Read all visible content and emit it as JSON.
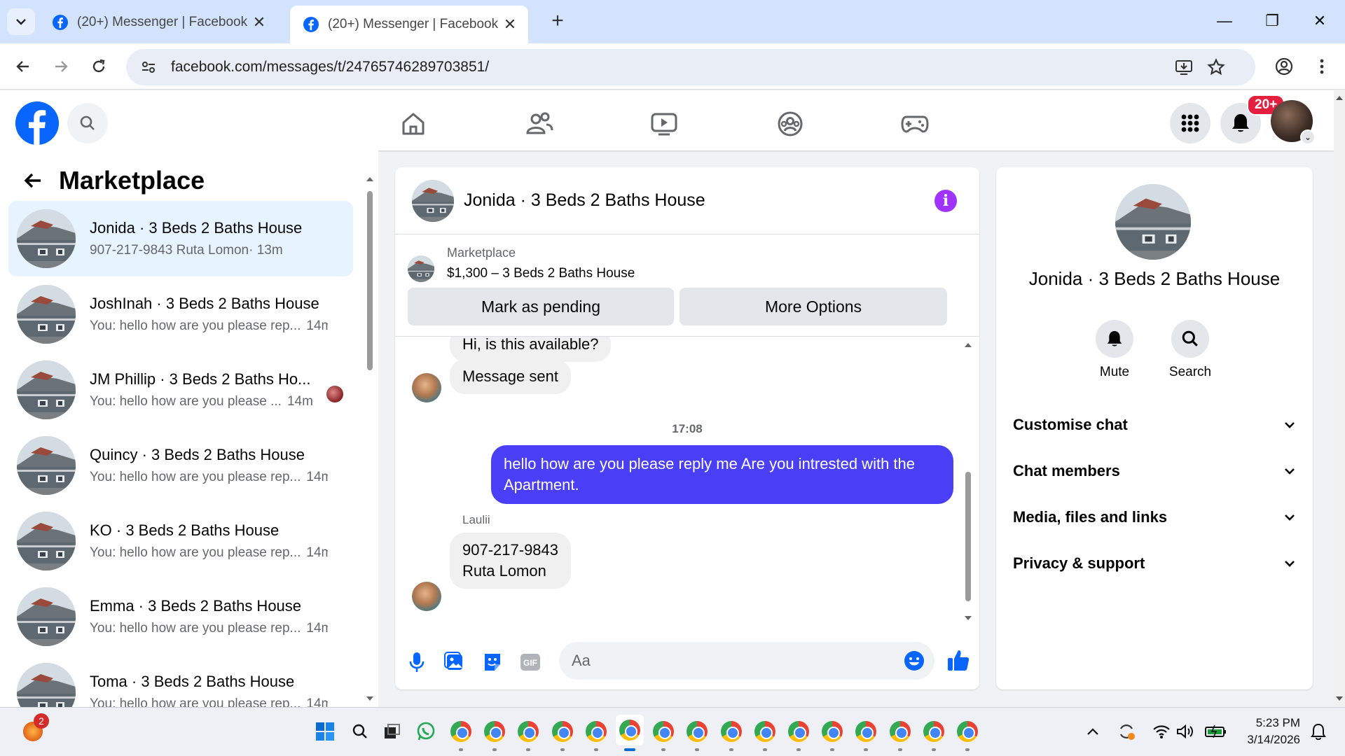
{
  "browser": {
    "tabs": [
      {
        "title": "(20+) Messenger | Facebook",
        "active": false
      },
      {
        "title": "(20+) Messenger | Facebook",
        "active": true
      }
    ],
    "url": "facebook.com/messages/t/24765746289703851/"
  },
  "fb_header": {
    "notification_count": "20+",
    "nav_icons": [
      "home-icon",
      "friends-icon",
      "watch-icon",
      "groups-icon",
      "gaming-icon"
    ],
    "brand_color": "#0866ff"
  },
  "sidebar": {
    "title": "Marketplace",
    "conversations": [
      {
        "name": "Jonida · 3 Beds 2 Baths House",
        "preview": "907-217-9843 Ruta Lomon",
        "time": "· 13m",
        "selected": true
      },
      {
        "name": "JoshInah · 3 Beds 2 Baths House",
        "preview": "You: hello how are you please rep...",
        "time": "14m"
      },
      {
        "name": "JM Phillip · 3 Beds 2 Baths Ho...",
        "preview": "You: hello how are you please ...",
        "time": "14m"
      },
      {
        "name": "Quincy · 3 Beds 2 Baths House",
        "preview": "You: hello how are you please rep...",
        "time": "14m"
      },
      {
        "name": "KO · 3 Beds 2 Baths House",
        "preview": "You: hello how are you please rep...",
        "time": "14m"
      },
      {
        "name": "Emma · 3 Beds 2 Baths House",
        "preview": "You: hello how are you please rep...",
        "time": "14m"
      },
      {
        "name": "Toma · 3 Beds 2 Baths House",
        "preview": "You: hello how are you please rep...",
        "time": "14m"
      }
    ]
  },
  "chat": {
    "title": "Jonida · 3 Beds 2 Baths House",
    "listing_source": "Marketplace",
    "listing_text": "$1,300 – 3 Beds 2 Baths House",
    "mark_pending": "Mark as pending",
    "more_options": "More Options",
    "messages": {
      "partial": "Hi, is this available?",
      "sent_notice": "Message sent",
      "timestamp": "17:08",
      "outgoing": "hello how are you please reply me Are you intrested  with the Apartment.",
      "sender": "Laulii",
      "incoming_line1": "907-217-9843",
      "incoming_line2": "Ruta Lomon"
    },
    "composer_placeholder": "Aa",
    "accent_color": "#4a3ef7"
  },
  "details": {
    "name": "Jonida · 3 Beds 2 Baths House",
    "mute_label": "Mute",
    "search_label": "Search",
    "sections": [
      "Customise chat",
      "Chat members",
      "Media, files and links",
      "Privacy & support"
    ]
  },
  "taskbar": {
    "time": "5:23 PM",
    "date": "3/14/2026",
    "badge": "2"
  }
}
